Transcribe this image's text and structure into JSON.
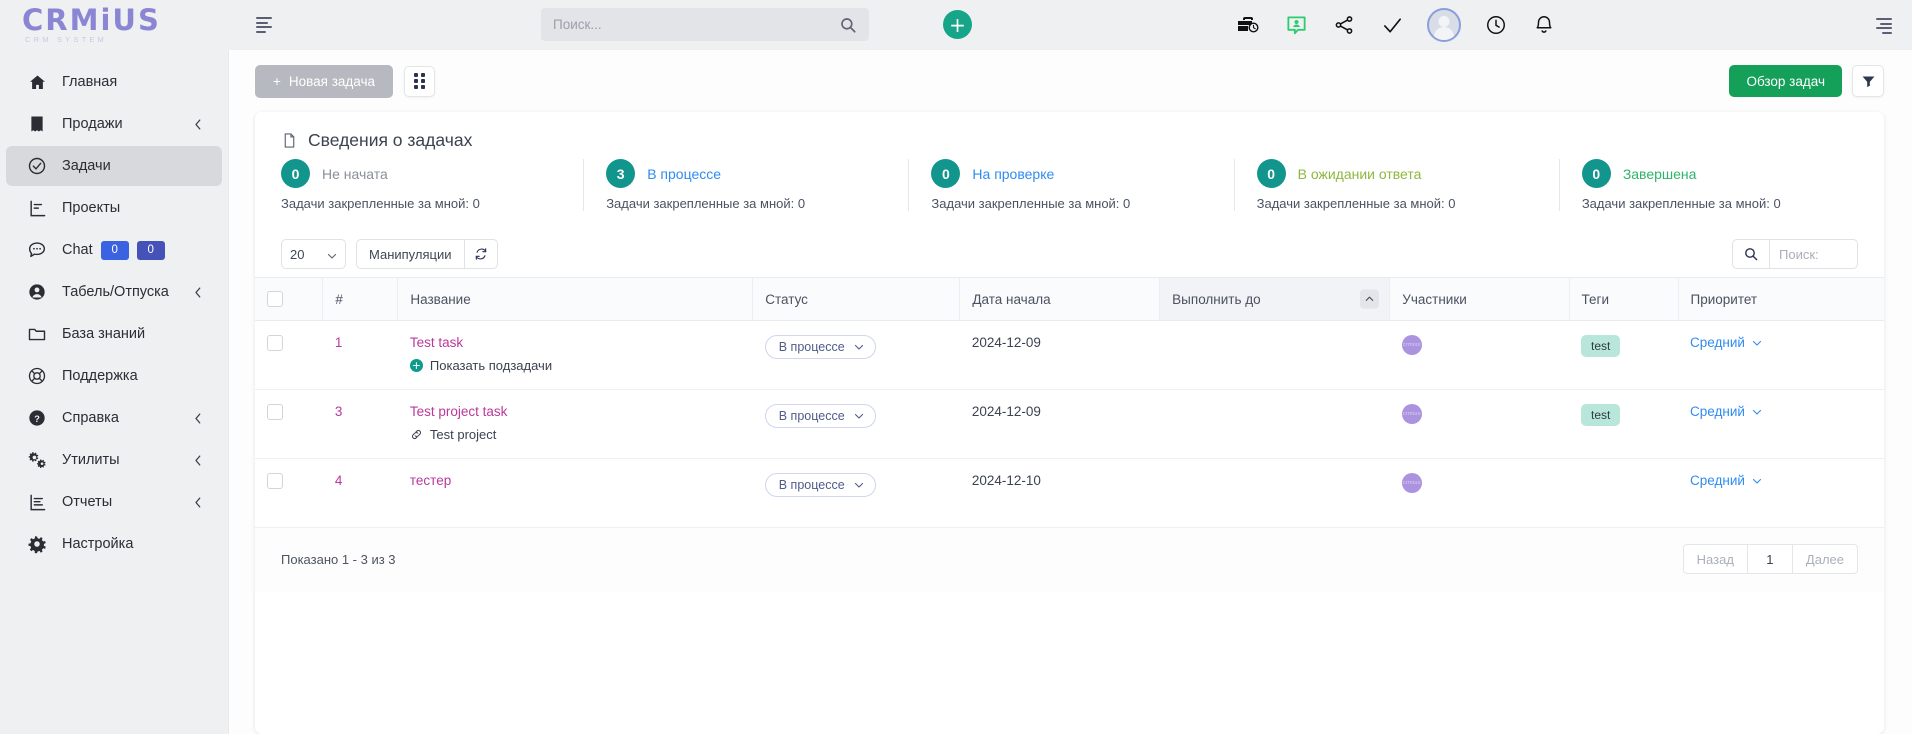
{
  "brand": {
    "name": "CRMiUS",
    "tagline": "CRM SYSTEM"
  },
  "topbar": {
    "menu_icon": "hamburger-icon",
    "search_placeholder": "Поиск...",
    "search_value": "",
    "add_label": "+",
    "icons": [
      "briefcase-clock-icon",
      "message-user-icon",
      "share-icon",
      "check-icon",
      "avatar",
      "clock-icon",
      "bell-icon",
      "hamburger-icon"
    ]
  },
  "sidebar": {
    "items": [
      {
        "label": "Главная",
        "icon": "home-icon",
        "chevron": false,
        "active": false
      },
      {
        "label": "Продажи",
        "icon": "receipt-icon",
        "chevron": true,
        "active": false
      },
      {
        "label": "Задачи",
        "icon": "check-circle-icon",
        "chevron": false,
        "active": true
      },
      {
        "label": "Проекты",
        "icon": "chart-icon",
        "chevron": false,
        "active": false
      },
      {
        "label": "Chat",
        "icon": "chat-icon",
        "chevron": false,
        "active": false,
        "badges": [
          "0",
          "0"
        ]
      },
      {
        "label": "Табель/Отпуска",
        "icon": "user-circle-icon",
        "chevron": true,
        "active": false
      },
      {
        "label": "База знаний",
        "icon": "folder-icon",
        "chevron": false,
        "active": false
      },
      {
        "label": "Поддержка",
        "icon": "lifebuoy-icon",
        "chevron": false,
        "active": false
      },
      {
        "label": "Справка",
        "icon": "question-circle-icon",
        "chevron": true,
        "active": false
      },
      {
        "label": "Утилиты",
        "icon": "gears-icon",
        "chevron": true,
        "active": false
      },
      {
        "label": "Отчеты",
        "icon": "report-icon",
        "chevron": true,
        "active": false
      },
      {
        "label": "Настройка",
        "icon": "gear-icon",
        "chevron": false,
        "active": false
      }
    ]
  },
  "actions": {
    "new_task_label": "Новая задача",
    "new_task_plus": "+",
    "grid_view_icon": "grid-view-icon",
    "overview_label": "Обзор задач",
    "filter_icon": "filter-icon",
    "overview_color": "#14a058"
  },
  "summary": {
    "title": "Сведения о задачах",
    "doc_icon": "document-icon",
    "cells": [
      {
        "count": "0",
        "name": "Не начата",
        "color": "#8a8f9b",
        "sub": "Задачи закрепленные за мной: 0"
      },
      {
        "count": "3",
        "name": "В процессе",
        "color": "#2f8cf0",
        "sub": "Задачи закрепленные за мной: 0"
      },
      {
        "count": "0",
        "name": "На проверке",
        "color": "#2f8cf0",
        "sub": "Задачи закрепленные за мной: 0"
      },
      {
        "count": "0",
        "name": "В ожидании ответа",
        "color": "#8cb83f",
        "sub": "Задачи закрепленные за мной: 0"
      },
      {
        "count": "0",
        "name": "Завершена",
        "color": "#2fb36a",
        "sub": "Задачи закрепленные за мной: 0"
      }
    ]
  },
  "toolbar": {
    "page_length": "20",
    "page_length_options": [
      "20"
    ],
    "manipulations_label": "Манипуляции",
    "refresh_icon": "refresh-icon",
    "search_icon": "search-icon",
    "search_placeholder": "Поиск:",
    "search_value": ""
  },
  "table": {
    "columns": [
      {
        "label": "",
        "key": "checkbox"
      },
      {
        "label": "#",
        "key": "id"
      },
      {
        "label": "Название",
        "key": "name"
      },
      {
        "label": "Статус",
        "key": "status"
      },
      {
        "label": "Дата начала",
        "key": "start_date"
      },
      {
        "label": "Выполнить до",
        "key": "due_date",
        "sorted": true,
        "sort_dir": "asc"
      },
      {
        "label": "Участники",
        "key": "members"
      },
      {
        "label": "Теги",
        "key": "tags"
      },
      {
        "label": "Приоритет",
        "key": "priority"
      }
    ],
    "rows": [
      {
        "id": "1",
        "name": "Test task",
        "sub_label": "Показать подзадачи",
        "sub_icon": "plus-circle-icon",
        "status": "В процессе",
        "start_date": "2024-12-09",
        "due_date": "",
        "member_initials": "crmius",
        "tag": "test",
        "priority": "Средний"
      },
      {
        "id": "3",
        "name": "Test project task",
        "sub_label": "Test project",
        "sub_icon": "link-icon",
        "status": "В процессе",
        "start_date": "2024-12-09",
        "due_date": "",
        "member_initials": "crmius",
        "tag": "test",
        "priority": "Средний"
      },
      {
        "id": "4",
        "name": "тестер",
        "sub_label": "",
        "sub_icon": "",
        "status": "В процессе",
        "start_date": "2024-12-10",
        "due_date": "",
        "member_initials": "crmius",
        "tag": "",
        "priority": "Средний"
      }
    ]
  },
  "footer": {
    "info": "Показано 1 - 3 из 3",
    "prev_label": "Назад",
    "page_label": "1",
    "next_label": "Далее"
  }
}
